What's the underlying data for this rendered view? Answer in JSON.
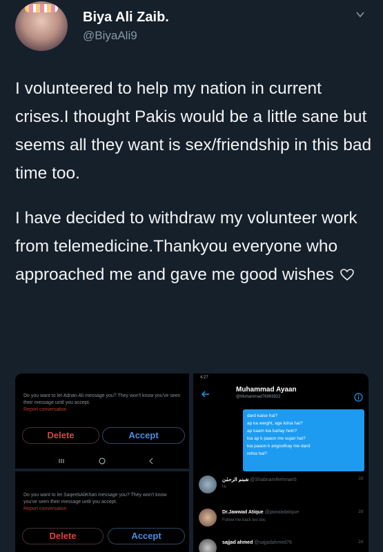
{
  "tweet": {
    "author_name": "Biya Ali Zaib.",
    "author_handle": "@BiyaAli9",
    "paragraph1": "I volunteered to help my nation in current crises.I thought Pakis would be a little sane but seems all they want is sex/friendship in this bad time too.",
    "paragraph2": "I have decided to withdraw my volunteer work from telemedicine.Thankyou everyone who approached me and gave me good wishes",
    "icons": {
      "more": "chevron-down-icon",
      "heart": "heart-outline-icon"
    }
  },
  "media": {
    "request1": {
      "text": "Do you want to let Adnan Ali message you? They won't know you've seen their message until you accept.",
      "link": "Report conversation",
      "delete_label": "Delete",
      "accept_label": "Accept"
    },
    "request2": {
      "text": "Do you want to let SaqeebAliKhan message you? They won't know you've seen their message until you accept.",
      "link": "Report conversation",
      "delete_label": "Delete",
      "accept_label": "Accept"
    },
    "dm": {
      "status_time": "4:27",
      "contact_name": "Muhammad Ayaan",
      "contact_handle": "@Muhammad76993922",
      "messages": [
        "dard kaise hai?",
        "ap ka weight, age kitna hai?",
        "ap kaam kia kartay hein?",
        "kia ap k paaon me sujan hai?",
        "kia paaon k angoothay me dard",
        "rehta hai?"
      ],
      "conversations": [
        {
          "name": "شبنم الرحمٰن",
          "handle": "@ShabnamRehman5",
          "preview": "Hi",
          "age": "2d"
        },
        {
          "name": "Dr.Jawwad Atique",
          "handle": "@jawwadatique",
          "preview": "Follow me back too doc",
          "age": "2d"
        },
        {
          "name": "sajjad ahmed",
          "handle": "@sajjadahmed78",
          "preview": "",
          "age": "2d"
        }
      ]
    }
  },
  "colors": {
    "background": "#15202b",
    "accent": "#1d9bf0",
    "danger": "#d9463f"
  }
}
